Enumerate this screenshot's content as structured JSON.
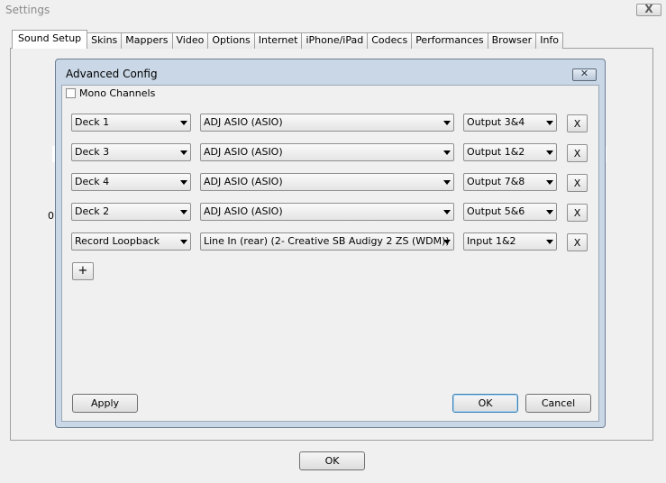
{
  "window": {
    "title": "Settings",
    "close_label": "X"
  },
  "tabs": [
    {
      "label": "Sound Setup",
      "active": true
    },
    {
      "label": "Skins"
    },
    {
      "label": "Mappers"
    },
    {
      "label": "Video"
    },
    {
      "label": "Options"
    },
    {
      "label": "Internet"
    },
    {
      "label": "iPhone/iPad"
    },
    {
      "label": "Codecs"
    },
    {
      "label": "Performances"
    },
    {
      "label": "Browser"
    },
    {
      "label": "Info"
    }
  ],
  "panel": {
    "marker": "0"
  },
  "dialog": {
    "title": "Advanced Config",
    "mono_label": "Mono Channels",
    "mono_checked": false,
    "rows": [
      {
        "deck": "Deck 1",
        "device": "ADJ ASIO (ASIO)",
        "channel": "Output 3&4",
        "remove": "X"
      },
      {
        "deck": "Deck 3",
        "device": "ADJ ASIO (ASIO)",
        "channel": "Output 1&2",
        "remove": "X"
      },
      {
        "deck": "Deck 4",
        "device": "ADJ ASIO (ASIO)",
        "channel": "Output 7&8",
        "remove": "X"
      },
      {
        "deck": "Deck 2",
        "device": "ADJ ASIO (ASIO)",
        "channel": "Output 5&6",
        "remove": "X"
      },
      {
        "deck": "Record Loopback",
        "device": "Line In (rear) (2- Creative SB Audigy 2 ZS (WDM))",
        "channel": "Input 1&2",
        "remove": "X"
      }
    ],
    "add_label": "+",
    "apply_label": "Apply",
    "ok_label": "OK",
    "cancel_label": "Cancel"
  },
  "footer": {
    "ok_label": "OK"
  }
}
